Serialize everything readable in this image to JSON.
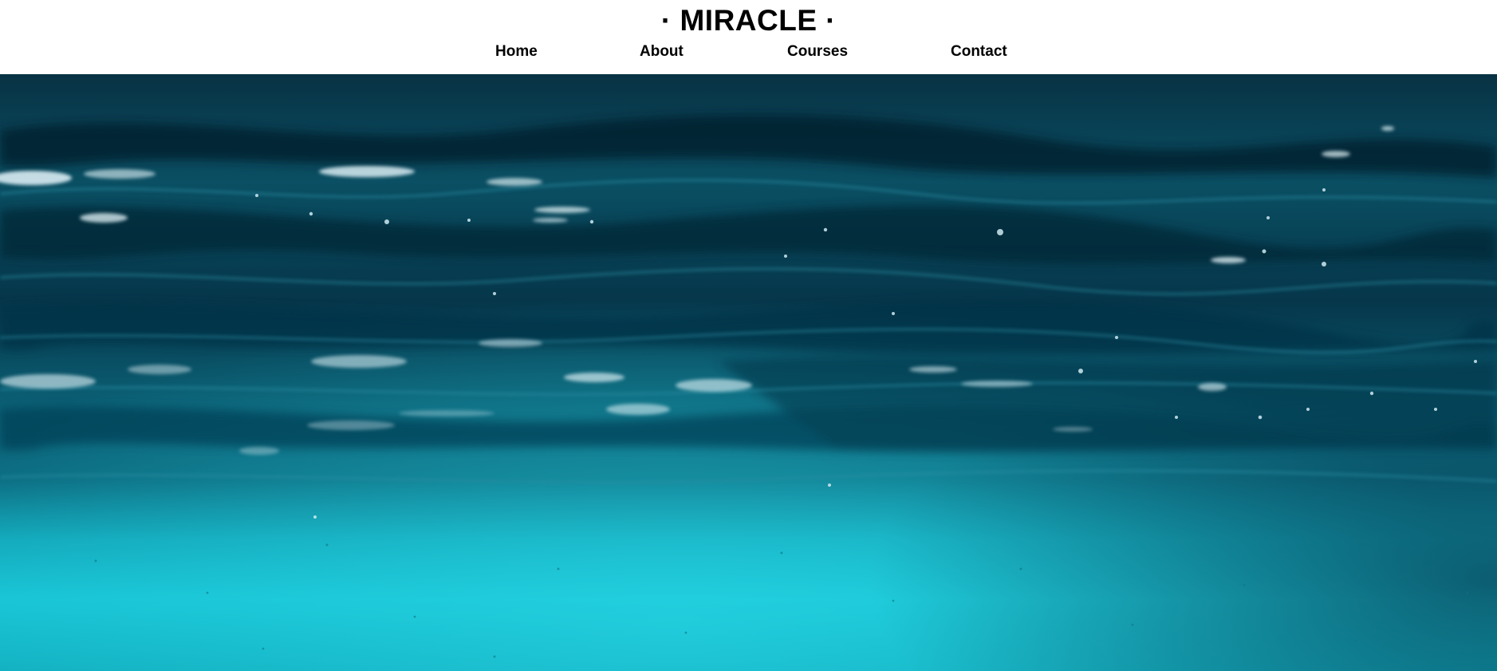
{
  "header": {
    "brand": "· MIRACLE ·"
  },
  "nav": {
    "items": [
      {
        "label": "Home"
      },
      {
        "label": "About"
      },
      {
        "label": "Courses"
      },
      {
        "label": "Contact"
      }
    ]
  },
  "hero": {
    "image": "underwater-ocean-surface",
    "colors": {
      "deep": "#062f3f",
      "mid": "#0b5a6e",
      "light": "#18c6d6",
      "highlight": "#dff4fa"
    }
  }
}
